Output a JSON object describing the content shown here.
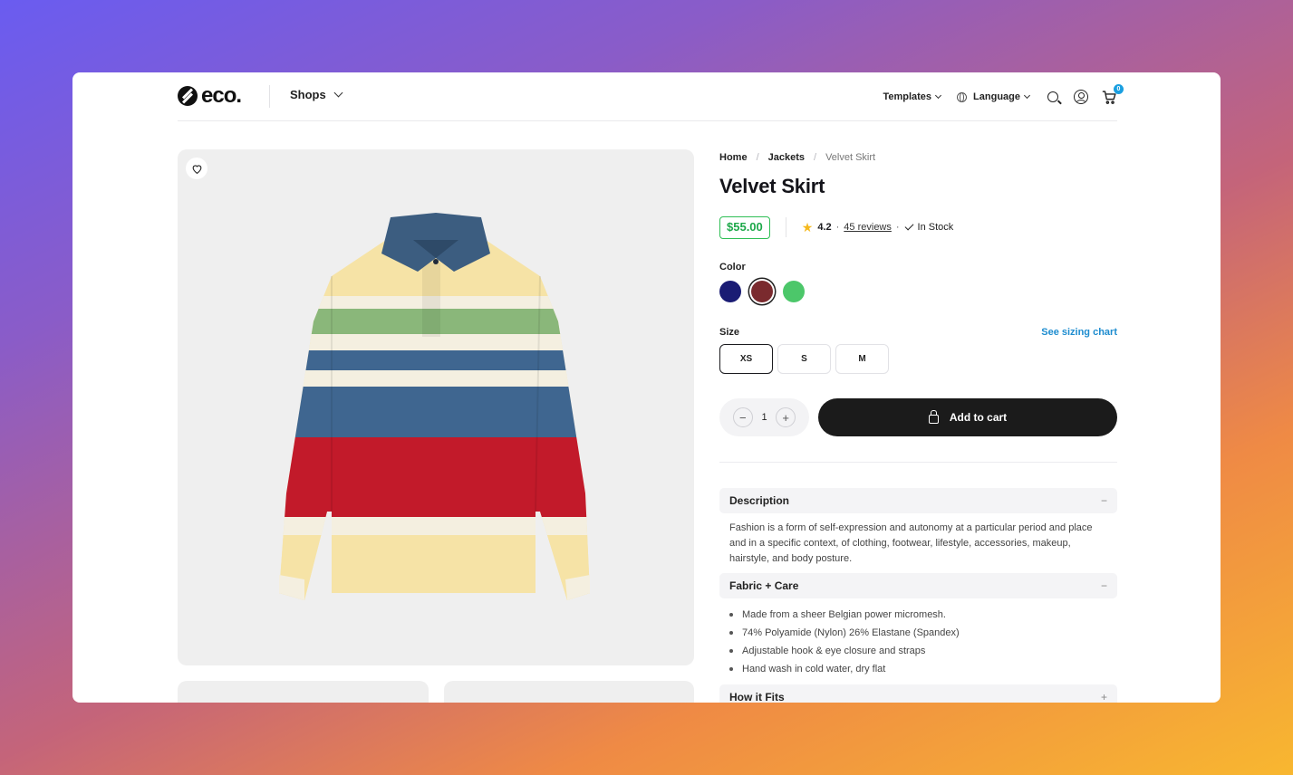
{
  "header": {
    "logo_text": "eco.",
    "shops_label": "Shops",
    "templates_label": "Templates",
    "language_label": "Language",
    "cart_count": "0"
  },
  "breadcrumb": [
    "Home",
    "Jackets",
    "Velvet Skirt"
  ],
  "product": {
    "title": "Velvet Skirt",
    "price": "$55.00",
    "rating": "4.2",
    "reviews": "45 reviews",
    "stock": "In Stock"
  },
  "color": {
    "label": "Color",
    "options": [
      "#1a1c74",
      "#7a2a2e",
      "#4cc76a"
    ],
    "selected": "#7a2a2e"
  },
  "size": {
    "label": "Size",
    "sizing_link": "See sizing chart",
    "options": [
      "XS",
      "S",
      "M"
    ],
    "selected": "XS"
  },
  "cart": {
    "quantity": "1",
    "minus": "−",
    "plus": "+",
    "add_label": "Add to cart"
  },
  "accordion": {
    "description": {
      "title": "Description",
      "toggle": "−",
      "text": "Fashion is a form of self-expression and autonomy at a particular period and place and in a specific context, of clothing, footwear, lifestyle, accessories, makeup, hairstyle, and body posture."
    },
    "fabric": {
      "title": "Fabric + Care",
      "toggle": "−",
      "items": [
        "Made from a sheer Belgian power micromesh.",
        "74% Polyamide (Nylon) 26% Elastane (Spandex)",
        "Adjustable hook & eye closure and straps",
        "Hand wash in cold water, dry flat"
      ]
    },
    "fits": {
      "title": "How it Fits",
      "toggle": "+"
    }
  },
  "icons": [
    "heart-icon",
    "search-icon",
    "user-icon",
    "cart-icon",
    "globe-icon",
    "bag-icon",
    "star-icon",
    "check-icon"
  ]
}
